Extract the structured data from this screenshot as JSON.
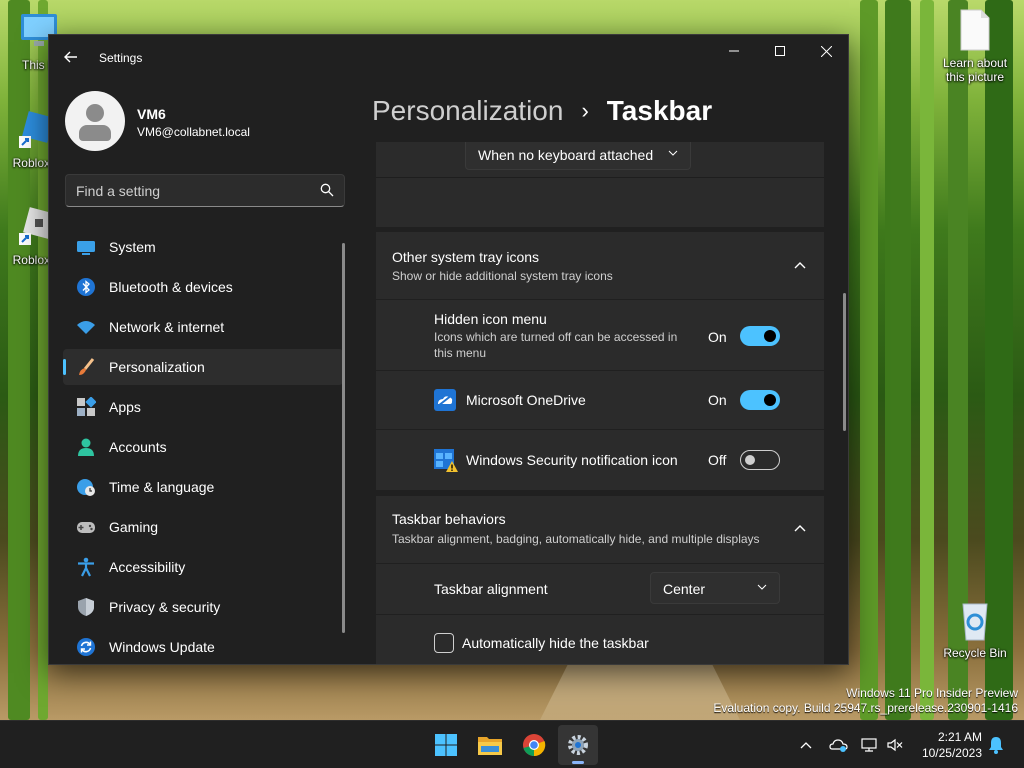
{
  "desktop": {
    "icons": [
      {
        "label": "This P"
      },
      {
        "label": "Roblox S"
      },
      {
        "label": "Roblox P"
      },
      {
        "label": "Learn about this picture"
      },
      {
        "label": "Recycle Bin"
      }
    ],
    "watermark": {
      "line1": "Windows 11 Pro Insider Preview",
      "line2": "Evaluation copy. Build 25947.rs_prerelease.230901-1416"
    }
  },
  "window": {
    "app_title": "Settings",
    "profile": {
      "name": "VM6",
      "email": "VM6@collabnet.local"
    },
    "search": {
      "placeholder": "Find a setting"
    },
    "nav": {
      "items": [
        {
          "label": "System",
          "icon": "system-icon",
          "selected": false
        },
        {
          "label": "Bluetooth & devices",
          "icon": "bluetooth-icon",
          "selected": false
        },
        {
          "label": "Network & internet",
          "icon": "wifi-icon",
          "selected": false
        },
        {
          "label": "Personalization",
          "icon": "brush-icon",
          "selected": true
        },
        {
          "label": "Apps",
          "icon": "apps-icon",
          "selected": false
        },
        {
          "label": "Accounts",
          "icon": "accounts-icon",
          "selected": false
        },
        {
          "label": "Time & language",
          "icon": "globe-clock-icon",
          "selected": false
        },
        {
          "label": "Gaming",
          "icon": "gamepad-icon",
          "selected": false
        },
        {
          "label": "Accessibility",
          "icon": "accessibility-icon",
          "selected": false
        },
        {
          "label": "Privacy & security",
          "icon": "shield-icon",
          "selected": false
        },
        {
          "label": "Windows Update",
          "icon": "update-icon",
          "selected": false
        }
      ]
    },
    "breadcrumb": {
      "parent": "Personalization",
      "separator": "›",
      "current": "Taskbar"
    },
    "content": {
      "touch_keyboard_dropdown": "When no keyboard attached",
      "other_tray": {
        "title": "Other system tray icons",
        "subtitle": "Show or hide additional system tray icons",
        "items": [
          {
            "title": "Hidden icon menu",
            "desc": "Icons which are turned off can be accessed in this menu",
            "state": "On",
            "on": true
          },
          {
            "title": "Microsoft OneDrive",
            "state": "On",
            "on": true,
            "icon": "onedrive-icon"
          },
          {
            "title": "Windows Security notification icon",
            "state": "Off",
            "on": false,
            "icon": "windows-security-icon"
          }
        ]
      },
      "behaviors": {
        "title": "Taskbar behaviors",
        "subtitle": "Taskbar alignment, badging, automatically hide, and multiple displays",
        "alignment_label": "Taskbar alignment",
        "alignment_value": "Center",
        "autohide_label": "Automatically hide the taskbar",
        "autohide_checked": false
      }
    }
  },
  "taskbar": {
    "apps": [
      "start-icon",
      "file-explorer-icon",
      "chrome-icon",
      "settings-icon"
    ],
    "clock": {
      "time": "2:21 AM",
      "date": "10/25/2023"
    }
  },
  "colors": {
    "accent": "#4cc2ff",
    "window_bg": "#202020",
    "card_bg": "#2b2b2b",
    "taskbar_bg": "#202020"
  }
}
